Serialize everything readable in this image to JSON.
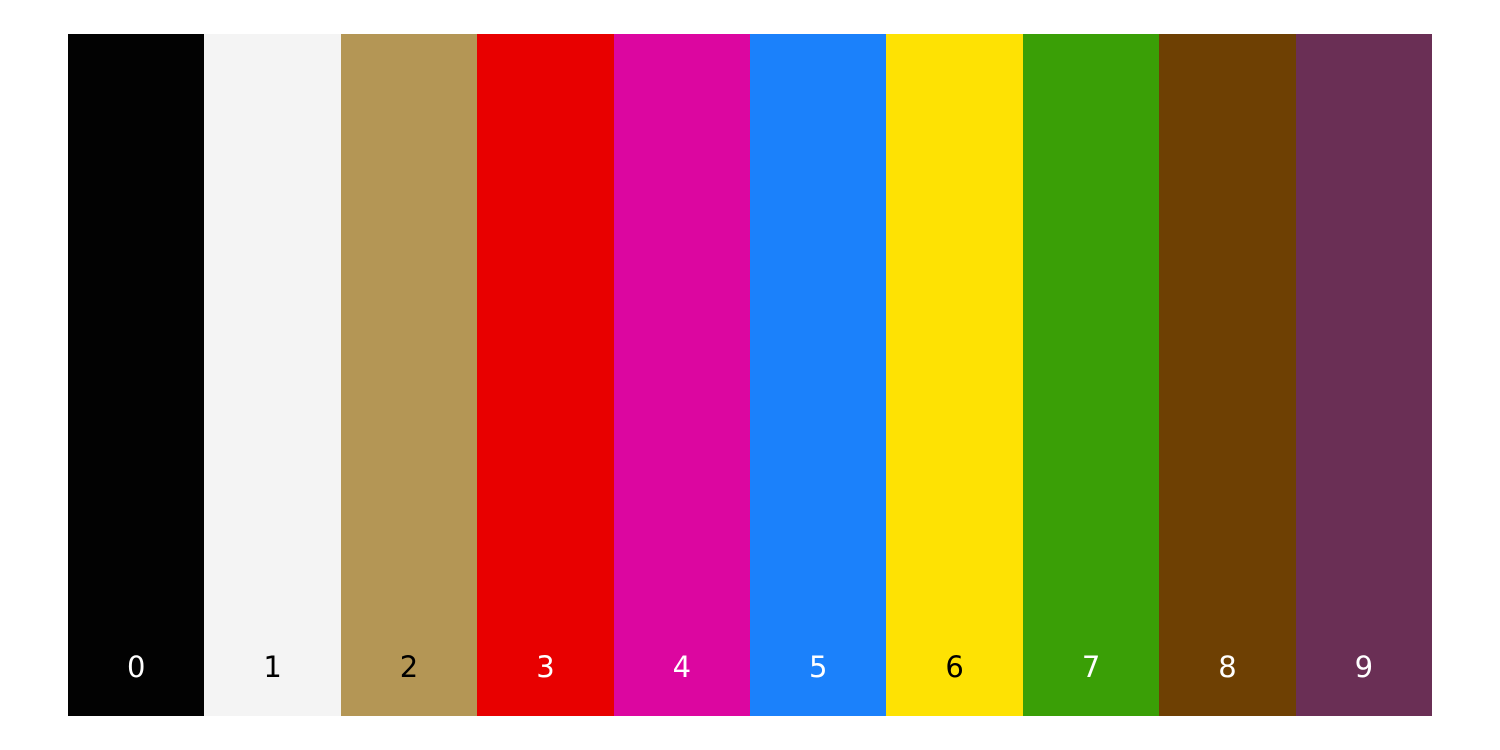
{
  "palette": {
    "swatches": [
      {
        "label": "0",
        "color": "#020202",
        "text_color": "#ffffff"
      },
      {
        "label": "1",
        "color": "#f4f4f4",
        "text_color": "#000000"
      },
      {
        "label": "2",
        "color": "#b49655",
        "text_color": "#000000"
      },
      {
        "label": "3",
        "color": "#e80000",
        "text_color": "#ffffff"
      },
      {
        "label": "4",
        "color": "#dc06a0",
        "text_color": "#ffffff"
      },
      {
        "label": "5",
        "color": "#1b81fb",
        "text_color": "#ffffff"
      },
      {
        "label": "6",
        "color": "#fee203",
        "text_color": "#000000"
      },
      {
        "label": "7",
        "color": "#3a9f06",
        "text_color": "#ffffff"
      },
      {
        "label": "8",
        "color": "#6e4003",
        "text_color": "#ffffff"
      },
      {
        "label": "9",
        "color": "#6a2f55",
        "text_color": "#ffffff"
      }
    ]
  }
}
